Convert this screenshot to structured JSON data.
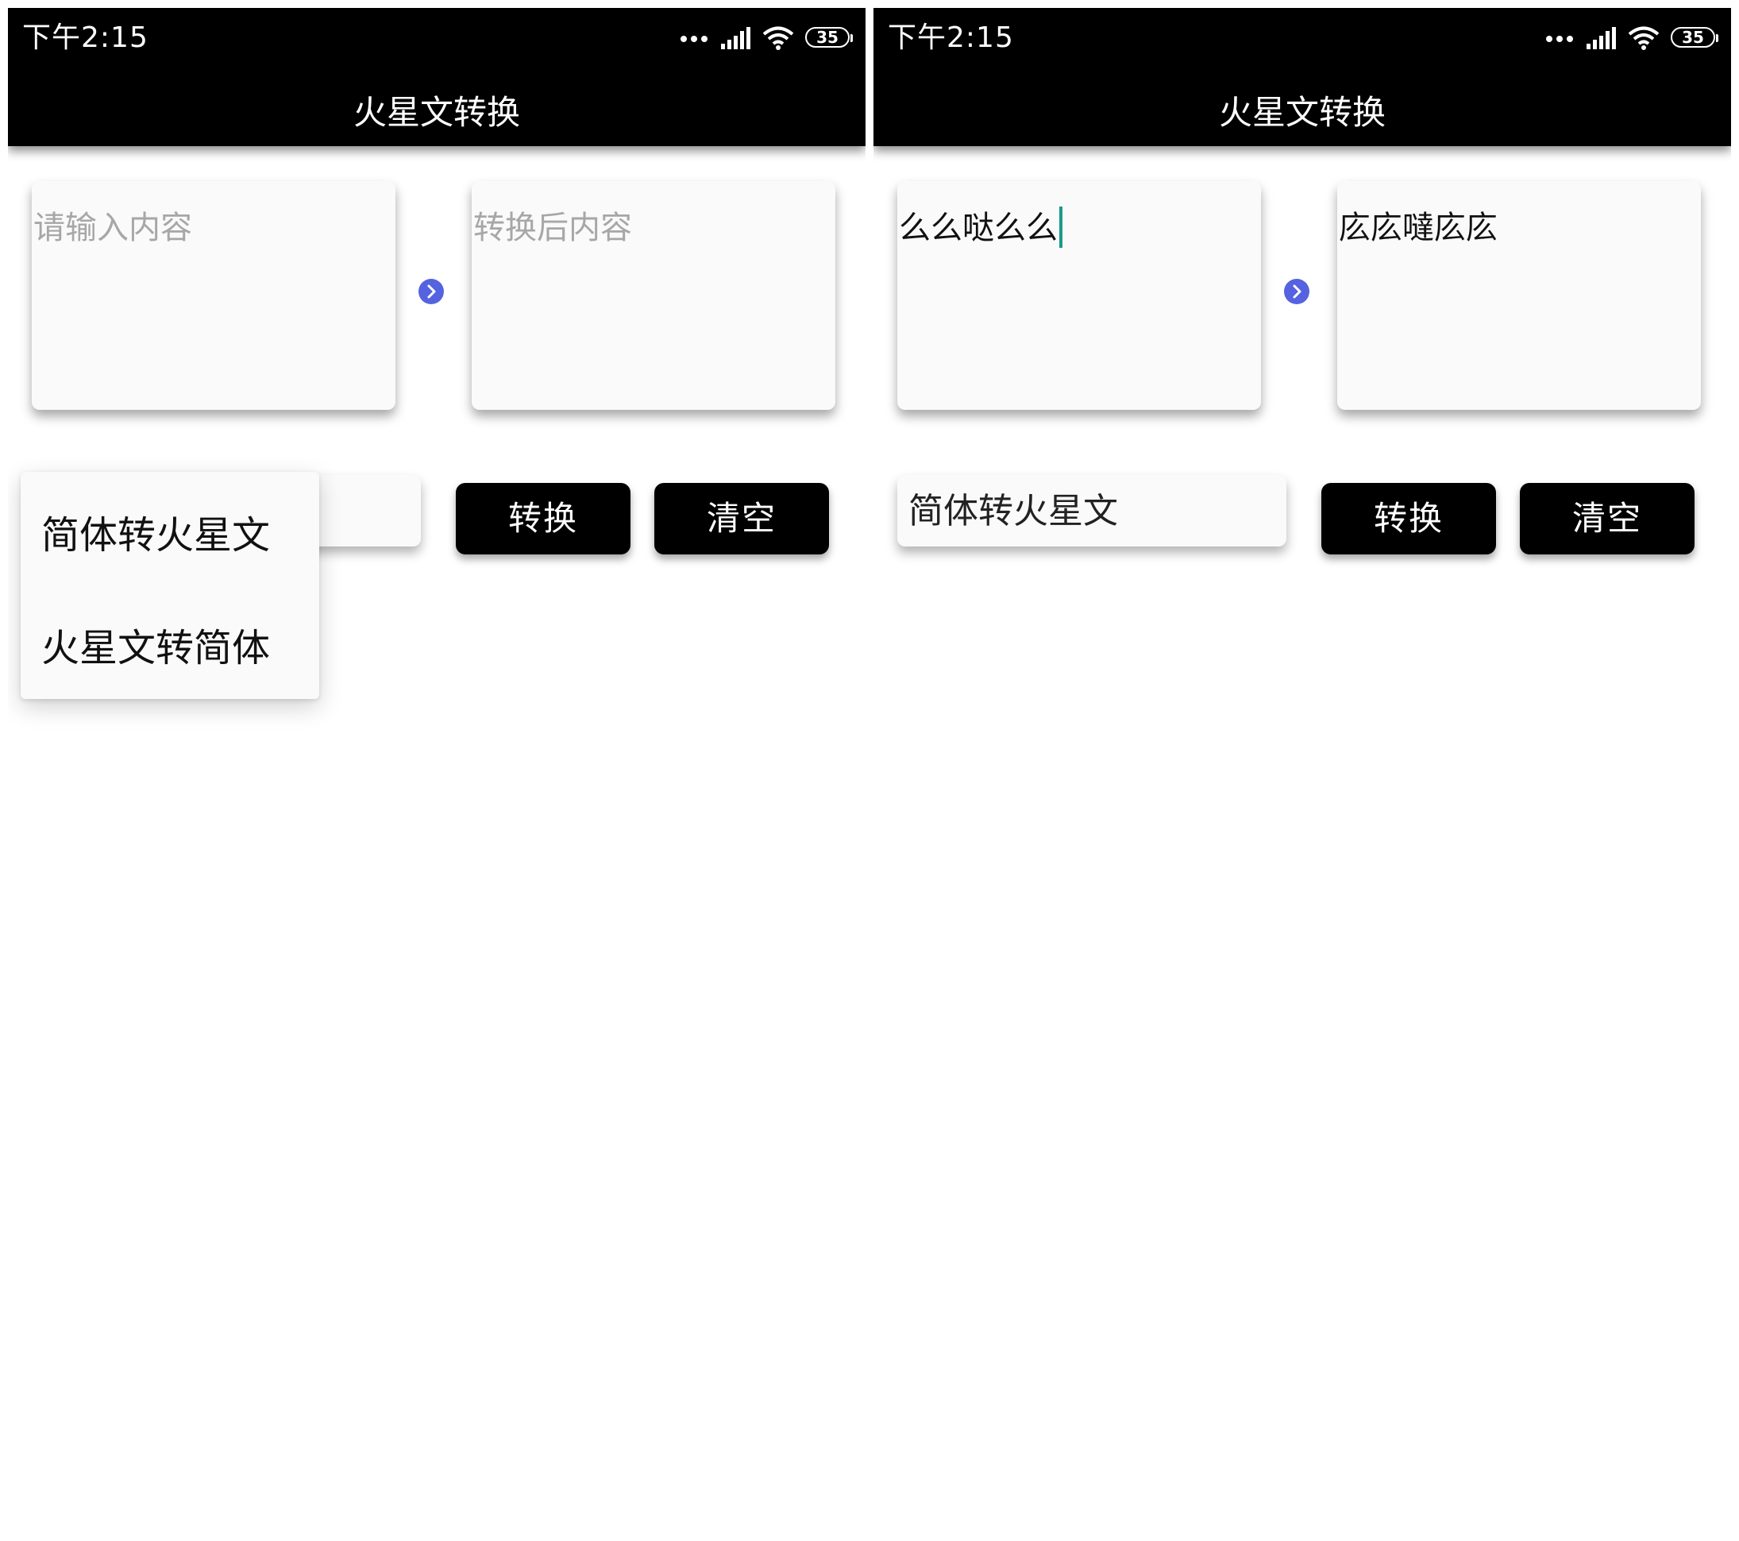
{
  "statusbar": {
    "time": "下午2:15",
    "battery_level": "35",
    "icons": [
      "more-dots-icon",
      "signal-icon",
      "wifi-icon",
      "battery-icon"
    ]
  },
  "app": {
    "title": "火星文转换"
  },
  "left_screen": {
    "input": {
      "value": "",
      "placeholder": "请输入内容"
    },
    "output": {
      "value": "",
      "placeholder": "转换后内容"
    },
    "dropdown_open": true,
    "dropdown_options": [
      "简体转火星文",
      "火星文转简体"
    ],
    "buttons": {
      "convert": "转换",
      "clear": "清空"
    }
  },
  "right_screen": {
    "input": {
      "value": "么么哒么么"
    },
    "output": {
      "value": "庅庅噠庅庅"
    },
    "spinner_selected": "简体转火星文",
    "buttons": {
      "convert": "转换",
      "clear": "清空"
    }
  },
  "colors": {
    "bar_background": "#000000",
    "card_background": "#fafafa",
    "arrow_accent": "#5563e0",
    "caret": "#1a9a8c",
    "placeholder": "#a7a7a7"
  }
}
